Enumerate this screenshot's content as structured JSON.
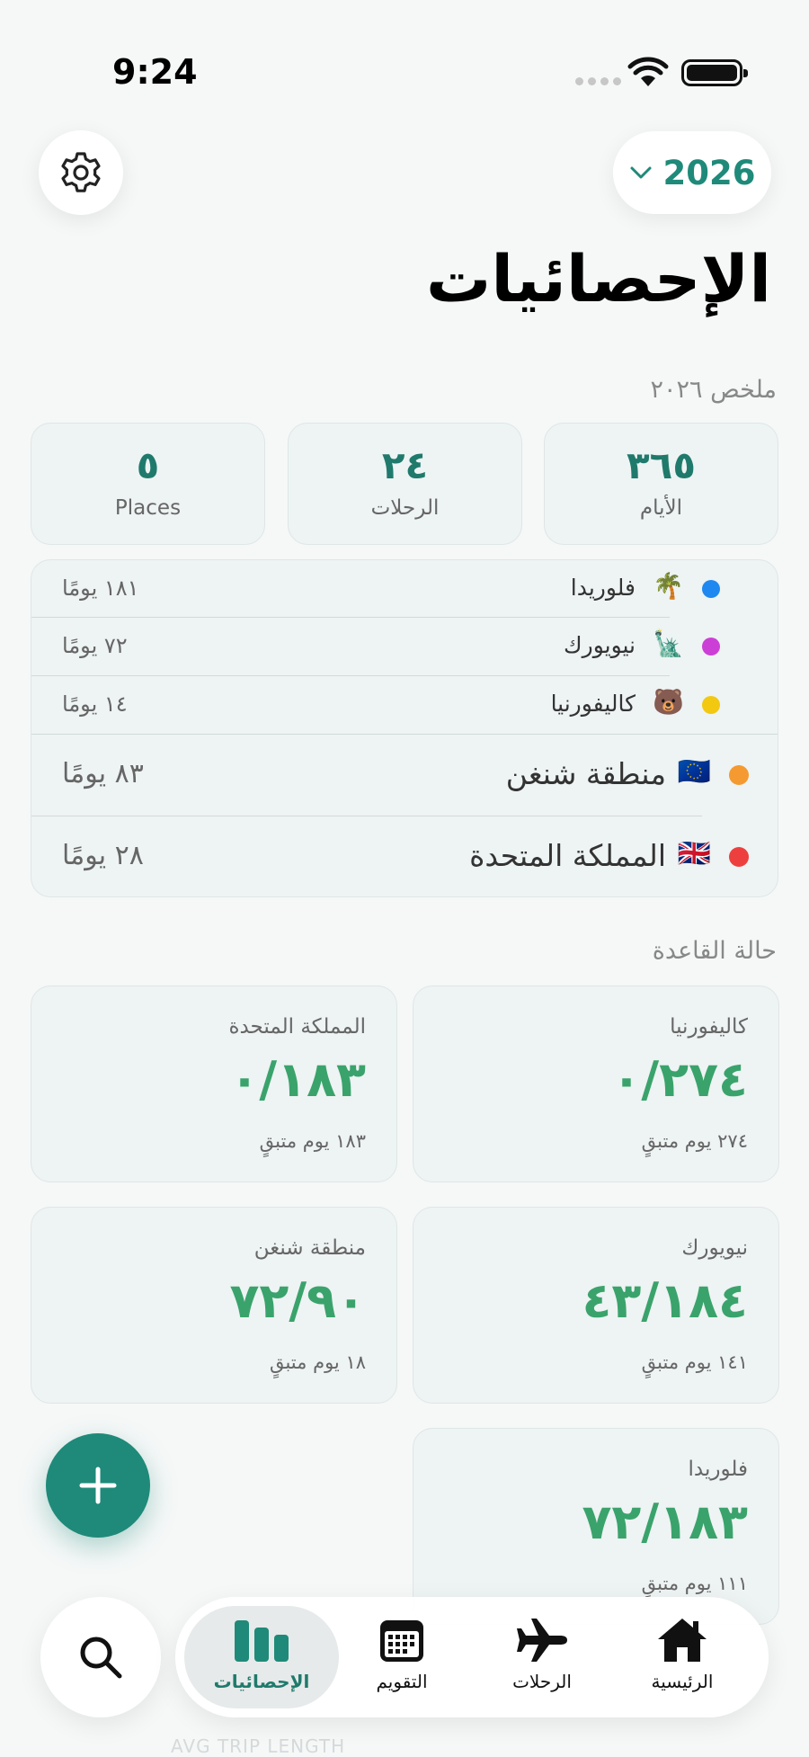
{
  "status": {
    "time": "9:24"
  },
  "header": {
    "year": "2026",
    "title": "الإحصائيات"
  },
  "summary": {
    "label": "ملخص ٢٠٢٦",
    "stats": [
      {
        "value": "٣٦٥",
        "label": "الأيام"
      },
      {
        "value": "٢٤",
        "label": "الرحلات"
      },
      {
        "value": "٥",
        "label": "Places"
      }
    ]
  },
  "places": [
    {
      "name": "فلوريدا",
      "emoji": "🌴",
      "days": "١٨١ يومًا",
      "color": "#1e88f0"
    },
    {
      "name": "نيويورك",
      "emoji": "🗽",
      "days": "٧٢ يومًا",
      "color": "#cc3fd6"
    },
    {
      "name": "كاليفورنيا",
      "emoji": "🐻",
      "days": "١٤ يومًا",
      "color": "#f2c811"
    },
    {
      "name": "منطقة شنغن",
      "emoji": "🇪🇺",
      "days": "٨٣ يومًا",
      "color": "#f59a30"
    },
    {
      "name": "المملكة المتحدة",
      "emoji": "🇬🇧",
      "days": "٢٨ يومًا",
      "color": "#ee3f3f"
    }
  ],
  "rules": {
    "label": "حالة القاعدة",
    "cards": [
      {
        "name": "كاليفورنيا",
        "value": "٠/٢٧٤",
        "remaining": "٢٧٤ يوم متبقٍ"
      },
      {
        "name": "المملكة المتحدة",
        "value": "٠/١٨٣",
        "remaining": "١٨٣ يوم متبقٍ"
      },
      {
        "name": "نيويورك",
        "value": "٤٣/١٨٤",
        "remaining": "١٤١ يوم متبقٍ"
      },
      {
        "name": "منطقة شنغن",
        "value": "٧٢/٩٠",
        "remaining": "١٨ يوم متبقٍ"
      },
      {
        "name": "فلوريدا",
        "value": "٧٢/١٨٣",
        "remaining": "١١١ يوم متبقٍ"
      }
    ]
  },
  "tabs": [
    {
      "label": "الرئيسية",
      "icon": "house-icon"
    },
    {
      "label": "الرحلات",
      "icon": "airplane-icon"
    },
    {
      "label": "التقويم",
      "icon": "calendar-icon"
    },
    {
      "label": "الإحصائيات",
      "icon": "chart-bars-icon",
      "active": true
    }
  ],
  "peek_text": "AVG TRIP LENGTH",
  "colors": {
    "accent": "#1f8a79",
    "rule_value": "#3aa36c"
  }
}
